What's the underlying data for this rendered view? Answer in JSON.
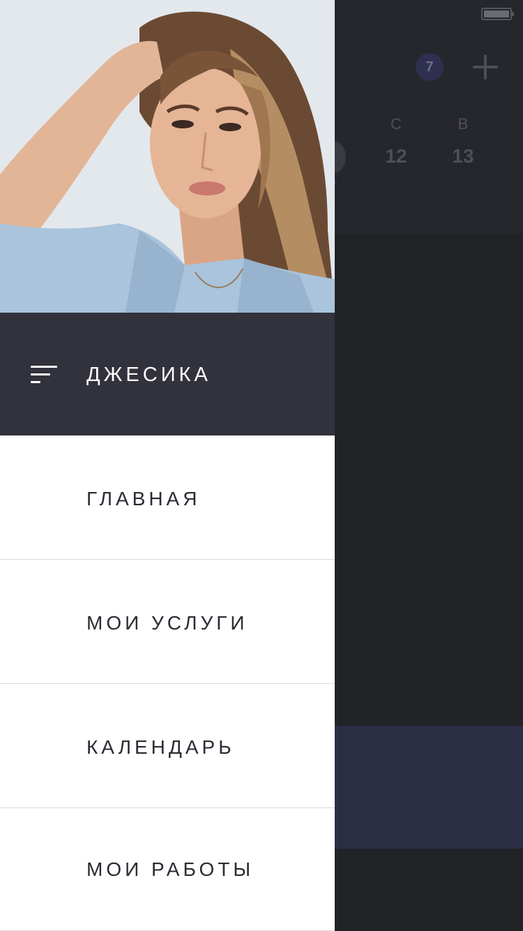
{
  "background": {
    "badge_count": "7",
    "week": [
      {
        "dow": "С",
        "day": "12"
      },
      {
        "dow": "В",
        "day": "13"
      }
    ]
  },
  "drawer": {
    "profile": {
      "name": "ДЖЕСИКА"
    },
    "menu": [
      {
        "label": "ГЛАВНАЯ"
      },
      {
        "label": "МОИ УСЛУГИ"
      },
      {
        "label": "КАЛЕНДАРЬ"
      },
      {
        "label": "МОИ РАБОТЫ"
      }
    ]
  }
}
